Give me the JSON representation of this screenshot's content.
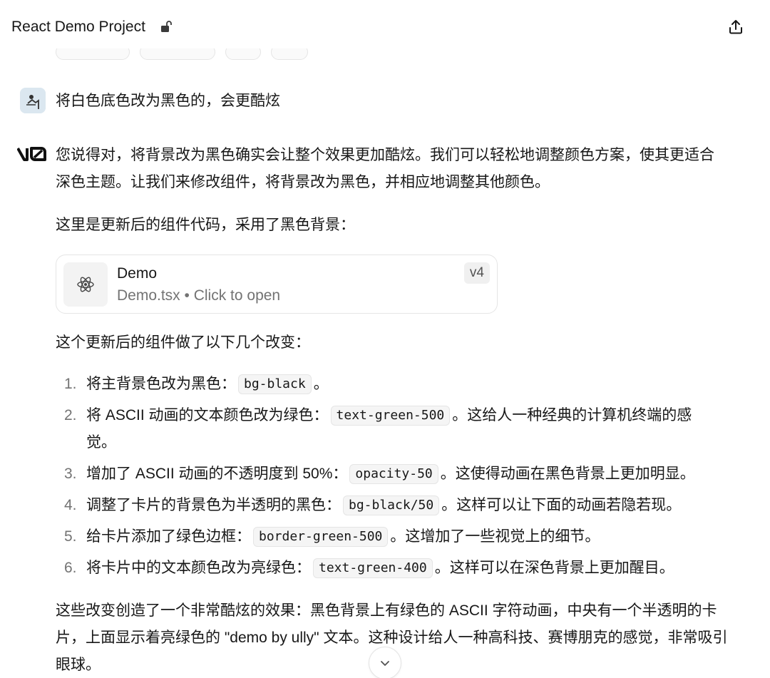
{
  "header": {
    "title": "React Demo Project",
    "lock_icon": "unlocked-lock-icon",
    "share_icon": "share-upload-icon"
  },
  "user_message": {
    "avatar_icon": "user-avatar",
    "text": "将白色底色改为黑色的，会更酷炫"
  },
  "assistant": {
    "logo_icon": "v0-logo",
    "intro": "您说得对，将背景改为黑色确实会让整个效果更加酷炫。我们可以轻松地调整颜色方案，使其更适合深色主题。让我们来修改组件，将背景改为黑色，并相应地调整其他颜色。",
    "here_text": "这里是更新后的组件代码，采用了黑色背景：",
    "card": {
      "icon": "react-atom-icon",
      "title": "Demo",
      "subtitle": "Demo.tsx • Click to open",
      "version": "v4"
    },
    "changes_intro": "这个更新后的组件做了以下几个改变：",
    "changes": [
      {
        "num": "1.",
        "before": "将主背景色改为黑色：",
        "code": "bg-black",
        "after": "。"
      },
      {
        "num": "2.",
        "before": "将 ASCII 动画的文本颜色改为绿色：",
        "code": "text-green-500",
        "after": "。这给人一种经典的计算机终端的感觉。"
      },
      {
        "num": "3.",
        "before": "增加了 ASCII 动画的不透明度到 50%：",
        "code": "opacity-50",
        "after": "。这使得动画在黑色背景上更加明显。"
      },
      {
        "num": "4.",
        "before": "调整了卡片的背景色为半透明的黑色：",
        "code": "bg-black/50",
        "after": "。这样可以让下面的动画若隐若现。"
      },
      {
        "num": "5.",
        "before": "给卡片添加了绿色边框：",
        "code": "border-green-500",
        "after": "。这增加了一些视觉上的细节。"
      },
      {
        "num": "6.",
        "before": "将卡片中的文本颜色改为亮绿色：",
        "code": "text-green-400",
        "after": "。这样可以在深色背景上更加醒目。"
      }
    ],
    "summary": "这些改变创造了一个非常酷炫的效果：黑色背景上有绿色的 ASCII 字符动画，中央有一个半透明的卡片，上面显示着亮绿色的 \"demo by ully\" 文本。这种设计给人一种高科技、赛博朋克的感觉，非常吸引眼球。"
  },
  "scroll_button": {
    "icon": "chevron-down-icon"
  },
  "colors": {
    "text": "#171717",
    "muted": "#737373",
    "border": "#e5e5e5",
    "code_bg": "#f5f5f5"
  }
}
